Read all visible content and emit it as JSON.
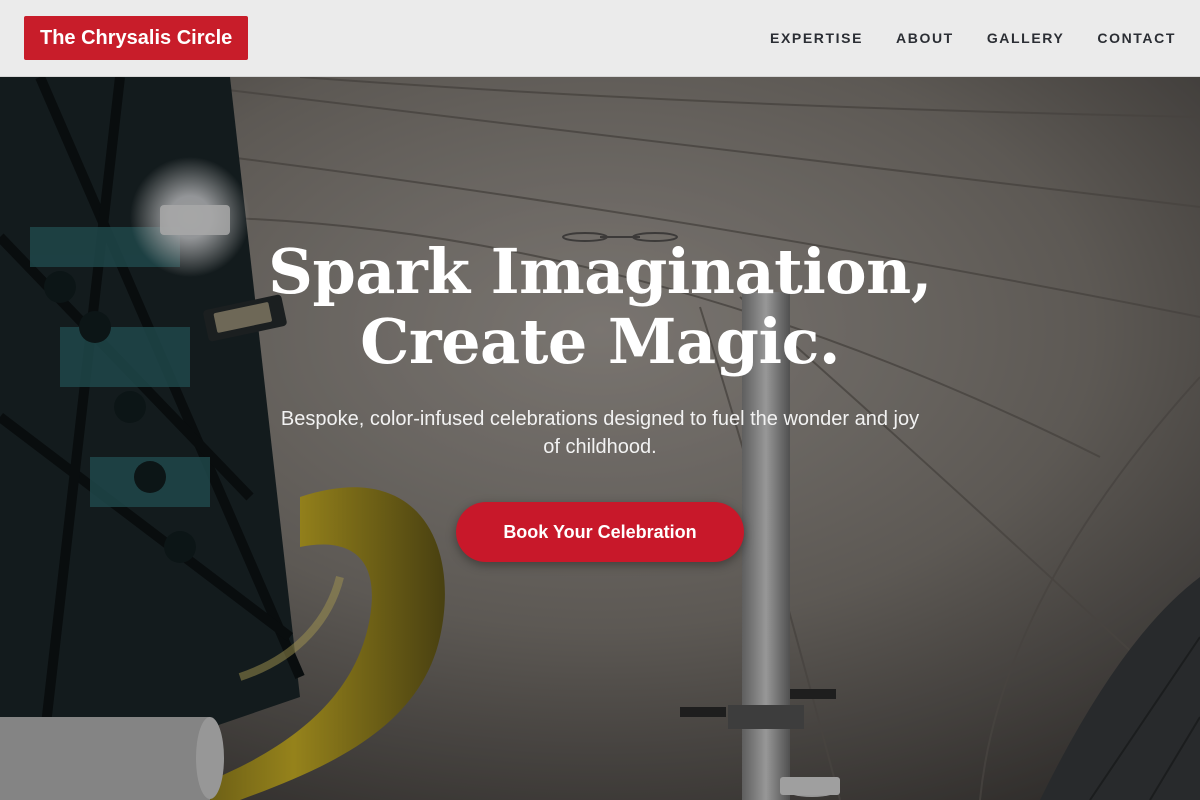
{
  "header": {
    "brand": "The Chrysalis Circle",
    "nav": [
      "EXPERTISE",
      "ABOUT",
      "GALLERY",
      "CONTACT"
    ]
  },
  "hero": {
    "headline_line1": "Spark Imagination,",
    "headline_line2": "Create Magic.",
    "subheadline": "Bespoke, color-infused celebrations designed to fuel the wonder and joy of childhood.",
    "cta_label": "Book Your Celebration",
    "background_image": "indoor-playground-tent-photo"
  },
  "colors": {
    "brand_red": "#c81d2a",
    "header_bg": "#ebebeb",
    "nav_text": "#2b2e34",
    "hero_text": "#ffffff"
  }
}
